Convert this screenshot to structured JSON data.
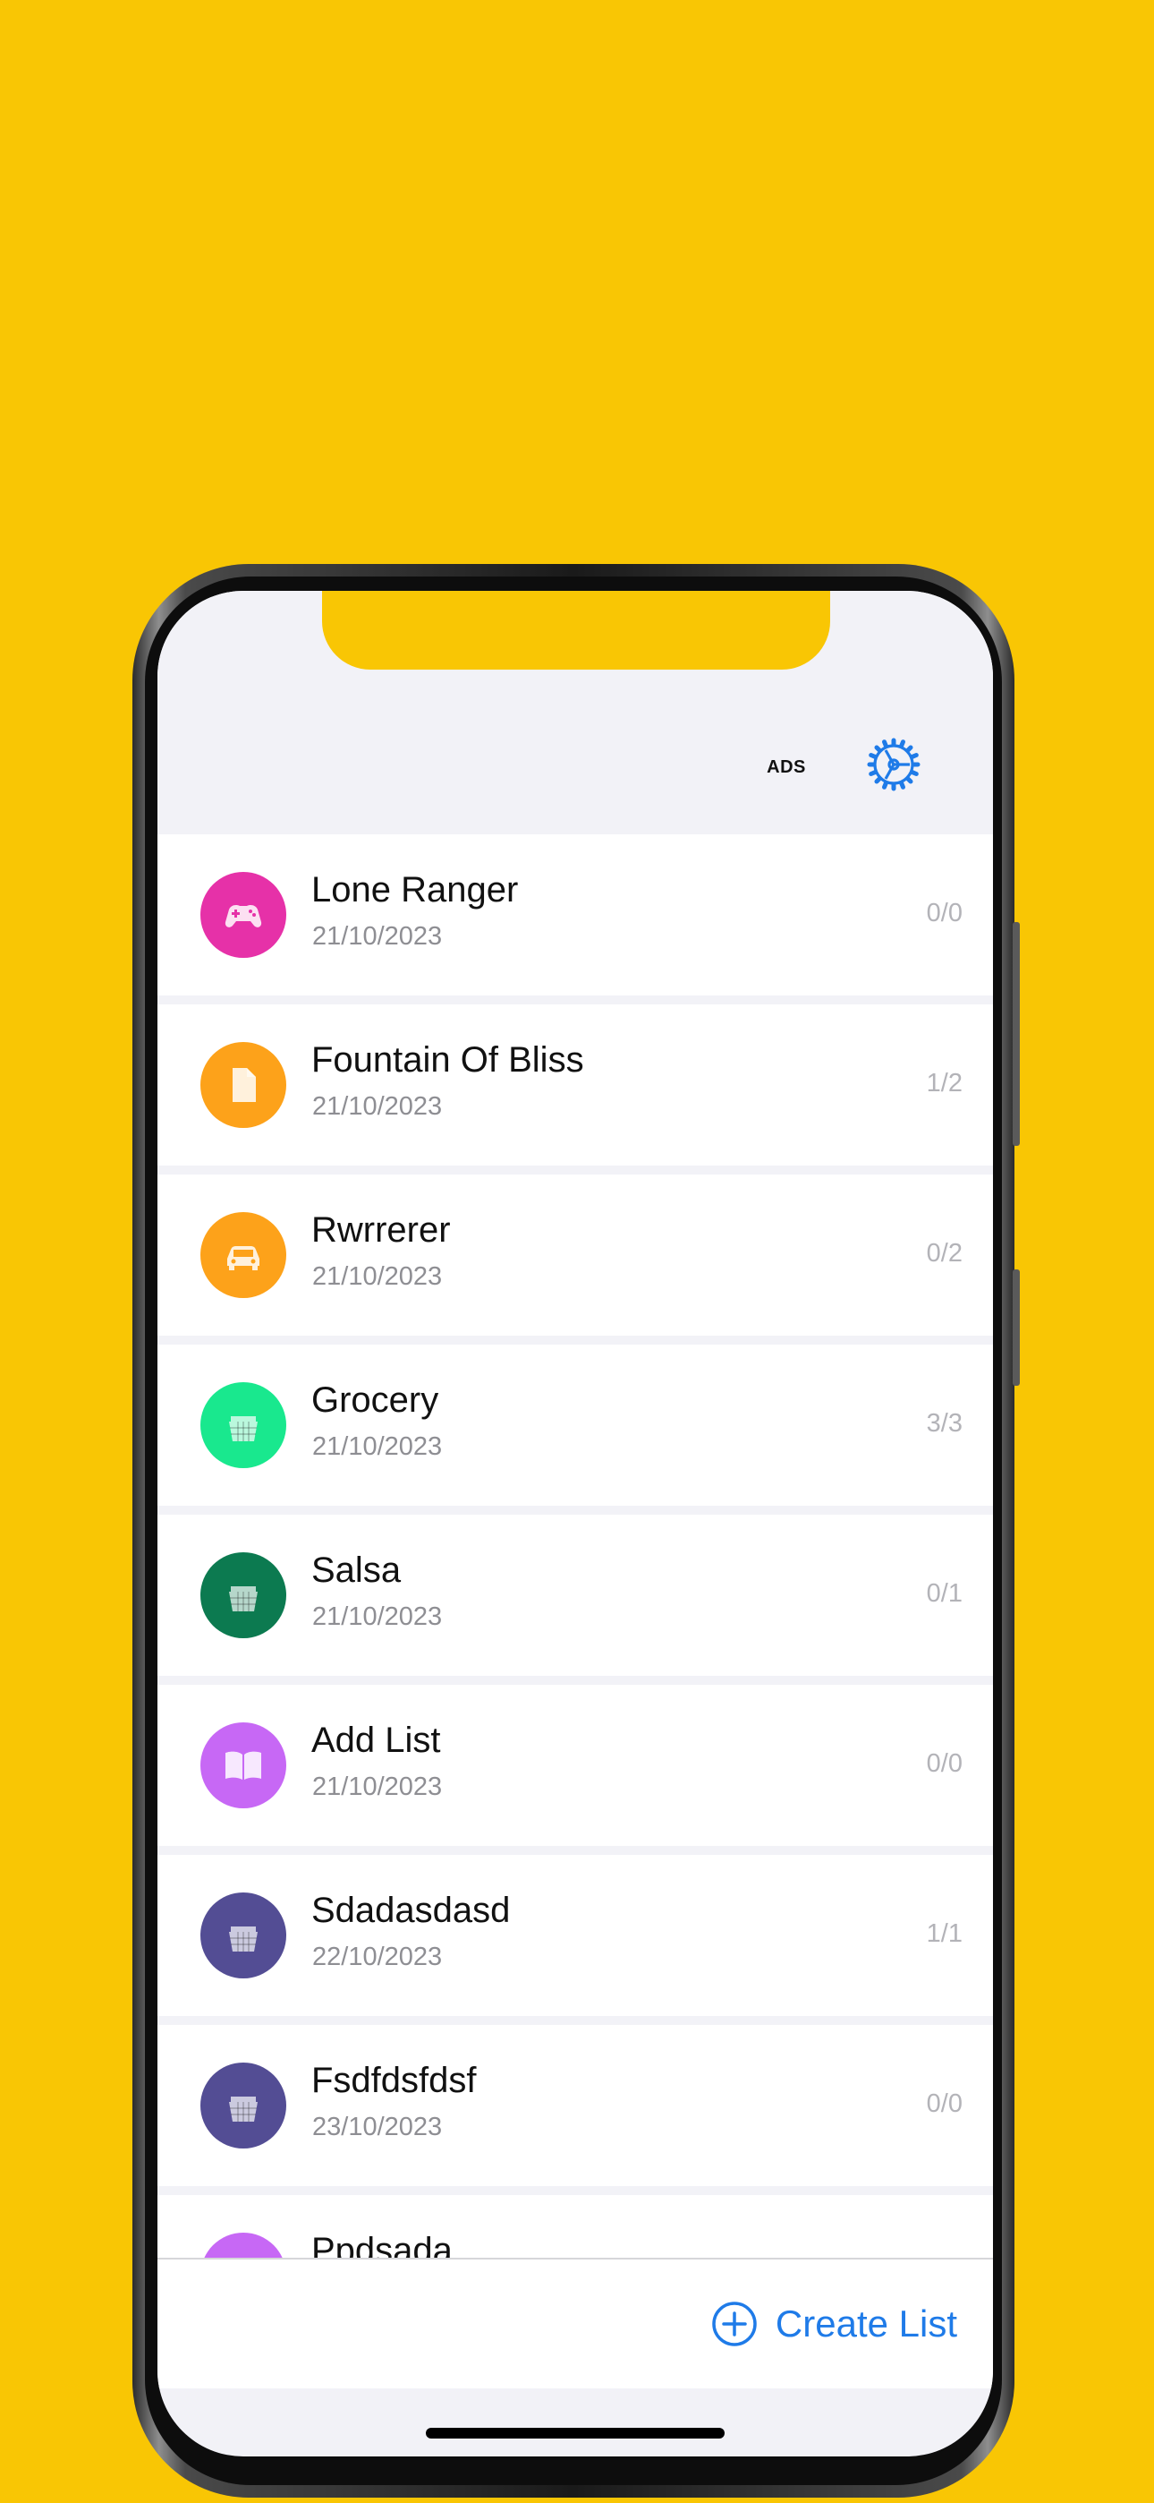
{
  "header": {
    "ads_label": "ADS"
  },
  "lists": [
    {
      "title": "Lone Ranger",
      "date": "21/10/2023",
      "count": "0/0",
      "color": "#E631A8",
      "icon": "gamepad-icon"
    },
    {
      "title": "Fountain Of Bliss",
      "date": "21/10/2023",
      "count": "1/2",
      "color": "#FDA21A",
      "icon": "document-icon"
    },
    {
      "title": "Rwrrerer",
      "date": "21/10/2023",
      "count": "0/2",
      "color": "#FDA21A",
      "icon": "car-icon"
    },
    {
      "title": "Grocery",
      "date": "21/10/2023",
      "count": "3/3",
      "color": "#19E88E",
      "icon": "basket-icon"
    },
    {
      "title": "Salsa",
      "date": "21/10/2023",
      "count": "0/1",
      "color": "#0C7A50",
      "icon": "basket-icon"
    },
    {
      "title": "Add List",
      "date": "21/10/2023",
      "count": "0/0",
      "color": "#C768F5",
      "icon": "book-icon"
    },
    {
      "title": "Sdadasdasd",
      "date": "22/10/2023",
      "count": "1/1",
      "color": "#534D94",
      "icon": "basket-icon"
    },
    {
      "title": "Fsdfdsfdsf",
      "date": "23/10/2023",
      "count": "0/0",
      "color": "#534D94",
      "icon": "basket-icon"
    },
    {
      "title": "Ppdsada",
      "date": "",
      "count": "",
      "color": "#C768F5",
      "icon": "basket-icon"
    }
  ],
  "footer": {
    "create_label": "Create List"
  },
  "colors": {
    "accent": "#1F7BE8",
    "background": "#F9C604"
  }
}
